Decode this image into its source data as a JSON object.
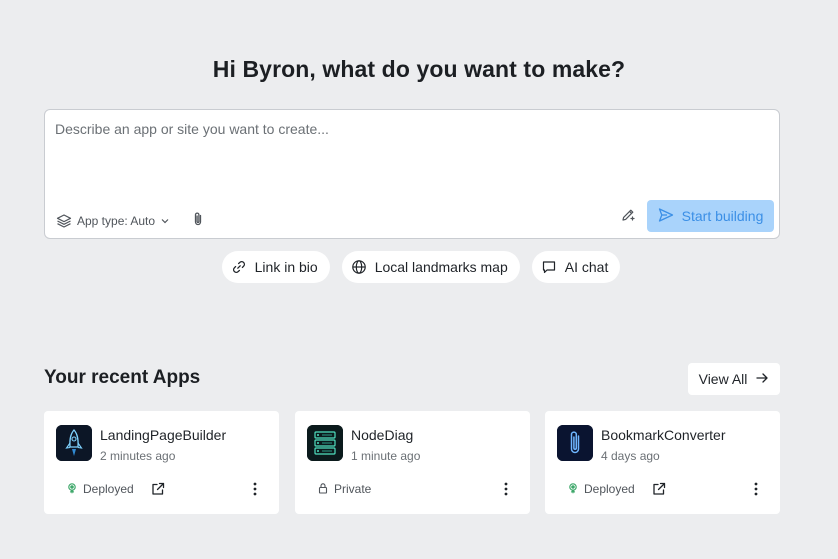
{
  "greeting": "Hi Byron, what do you want to make?",
  "composer": {
    "placeholder": "Describe an app or site you want to create...",
    "app_type_label": "App type: Auto",
    "start_label": "Start building"
  },
  "suggestions": [
    {
      "label": "Link in bio",
      "icon": "link-icon"
    },
    {
      "label": "Local landmarks map",
      "icon": "globe-icon"
    },
    {
      "label": "AI chat",
      "icon": "chat-bubble-icon"
    }
  ],
  "recent": {
    "title": "Your recent Apps",
    "view_all_label": "View All",
    "apps": [
      {
        "name": "LandingPageBuilder",
        "time": "2 minutes ago",
        "status": "Deployed",
        "status_icon": "deployed-icon",
        "thumbnail": "rocket-icon"
      },
      {
        "name": "NodeDiag",
        "time": "1 minute ago",
        "status": "Private",
        "status_icon": "lock-icon",
        "thumbnail": "server-icon"
      },
      {
        "name": "BookmarkConverter",
        "time": "4 days ago",
        "status": "Deployed",
        "status_icon": "deployed-icon",
        "thumbnail": "paperclip-icon"
      }
    ]
  },
  "colors": {
    "background": "#ecedef",
    "accent_button": "#a9d3fb",
    "accent_text": "#3b8fe6",
    "deployed_green": "#3fa86b"
  }
}
